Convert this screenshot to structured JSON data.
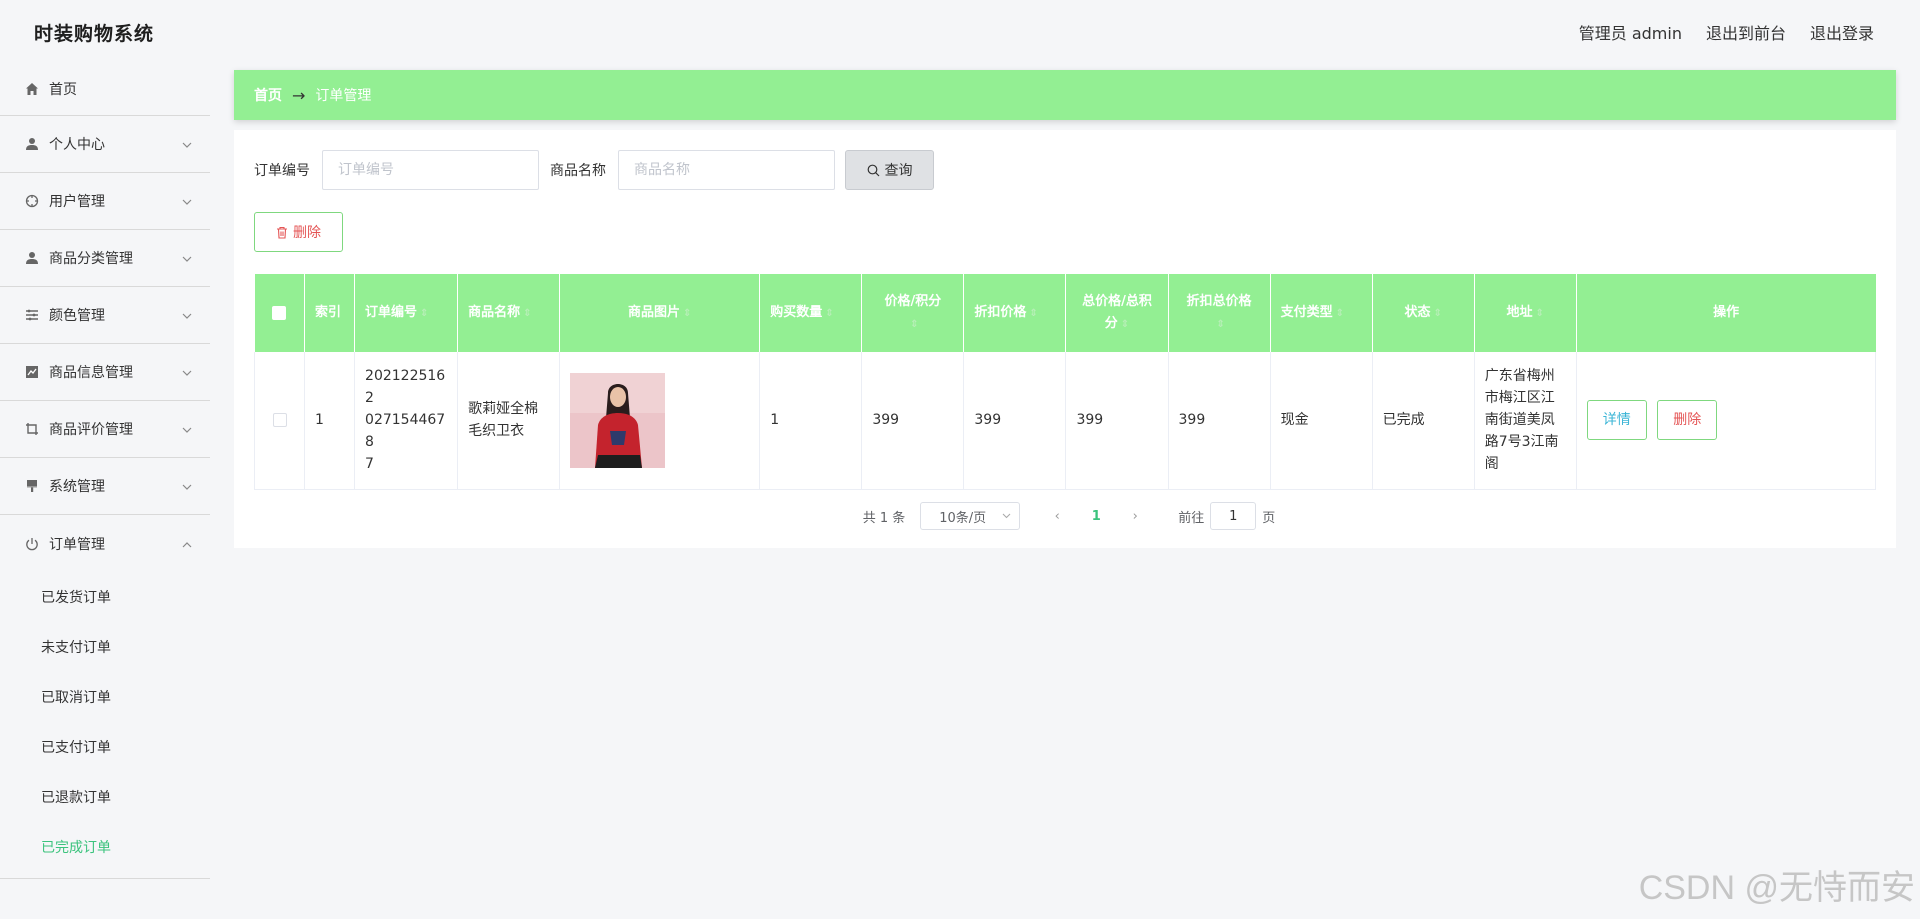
{
  "header": {
    "app_title": "时装购物系统",
    "admin_label": "管理员 admin",
    "exit_front_label": "退出到前台",
    "logout_label": "退出登录"
  },
  "sidebar": {
    "items": [
      {
        "label": "首页",
        "icon": "home-icon"
      },
      {
        "label": "个人中心",
        "icon": "user-icon"
      },
      {
        "label": "用户管理",
        "icon": "target-icon"
      },
      {
        "label": "商品分类管理",
        "icon": "user-icon"
      },
      {
        "label": "颜色管理",
        "icon": "list-icon"
      },
      {
        "label": "商品信息管理",
        "icon": "chart-icon"
      },
      {
        "label": "商品评价管理",
        "icon": "crop-icon"
      },
      {
        "label": "系统管理",
        "icon": "brush-icon"
      },
      {
        "label": "订单管理",
        "icon": "power-icon"
      }
    ],
    "sub_items": [
      "已发货订单",
      "未支付订单",
      "已取消订单",
      "已支付订单",
      "已退款订单",
      "已完成订单"
    ],
    "active_sub": "已完成订单"
  },
  "breadcrumb": {
    "home": "首页",
    "separator": "→",
    "current": "订单管理"
  },
  "search": {
    "order_no_label": "订单编号",
    "order_no_placeholder": "订单编号",
    "order_no_value": "",
    "product_name_label": "商品名称",
    "product_name_placeholder": "商品名称",
    "product_name_value": "",
    "query_label": "查询"
  },
  "toolbar": {
    "delete_label": "删除"
  },
  "table": {
    "columns": [
      "索引",
      "订单编号",
      "商品名称",
      "商品图片",
      "购买数量",
      "价格/积分",
      "折扣价格",
      "总价格/总积分",
      "折扣总价格",
      "支付类型",
      "状态",
      "地址",
      "操作"
    ],
    "rows": [
      {
        "index": "1",
        "order_no": "20212251620271544678 7",
        "order_no_display": "2021225162\n0271544678\n7",
        "product_name": "歌莉娅全棉毛织卫衣",
        "quantity": "1",
        "price": "399",
        "discount_price": "399",
        "total_price": "399",
        "discount_total": "399",
        "pay_type": "现金",
        "status": "已完成",
        "address": "广东省梅州市梅江区江南街道美凤路7号3江南阁",
        "detail_label": "详情",
        "delete_label": "删除"
      }
    ]
  },
  "pagination": {
    "total_text": "共 1 条",
    "page_size": "10条/页",
    "current_page": "1",
    "goto_label": "前往",
    "goto_value": "1",
    "page_unit": "页"
  },
  "watermark": "CSDN @无恃而安",
  "colors": {
    "accent_green": "#93ef93",
    "active_text": "#3bc37d",
    "danger": "#e45555",
    "info": "#3bb5d6"
  }
}
